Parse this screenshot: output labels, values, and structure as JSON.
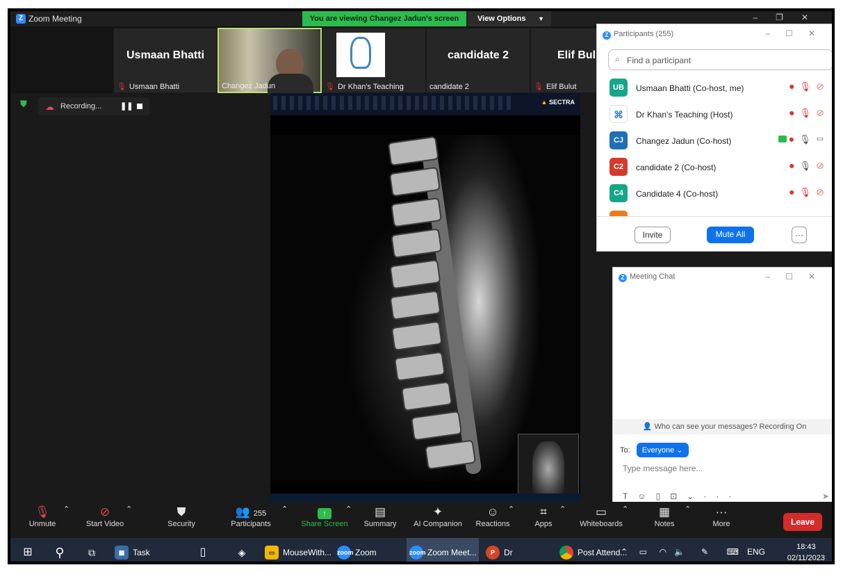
{
  "window": {
    "title": "Zoom Meeting",
    "viewing_banner": "You are viewing Changez Jadun's screen",
    "view_options": "View Options"
  },
  "thumbnails": [
    {
      "display": "Usmaan Bhatti",
      "name": "Usmaan Bhatti",
      "muted": true
    },
    {
      "display": "",
      "name": "Changez Jadun",
      "muted": false
    },
    {
      "display": "",
      "name": "Dr Khan's Teaching",
      "muted": true
    },
    {
      "display": "candidate 2",
      "name": "candidate 2",
      "muted": false
    },
    {
      "display": "Elif Bul",
      "name": "Elif Bulut",
      "muted": true
    }
  ],
  "recording": {
    "label": "Recording..."
  },
  "shared_screen": {
    "app_brand": "SECTRA"
  },
  "participants": {
    "title": "Participants (255)",
    "search_placeholder": "Find a participant",
    "list": [
      {
        "initials": "UB",
        "name": "Usmaan Bhatti (Co-host, me)",
        "color": "#17a589"
      },
      {
        "initials": "",
        "name": "Dr Khan's Teaching (Host)",
        "color": "#ffffff"
      },
      {
        "initials": "CJ",
        "name": "Changez Jadun (Co-host)",
        "color": "#1f6fb3"
      },
      {
        "initials": "C2",
        "name": "candidate 2 (Co-host)",
        "color": "#d33a2c"
      },
      {
        "initials": "C4",
        "name": "Candidate 4 (Co-host)",
        "color": "#17a589"
      }
    ],
    "invite": "Invite",
    "mute_all": "Mute All",
    "more": "···"
  },
  "chat": {
    "title": "Meeting Chat",
    "notice": "Who can see your messages? Recording On",
    "to_label": "To:",
    "to_value": "Everyone",
    "input_placeholder": "Type message here..."
  },
  "toolbar": {
    "unmute": "Unmute",
    "start_video": "Start Video",
    "security": "Security",
    "participants": "Participants",
    "participants_count": "255",
    "share_screen": "Share Screen",
    "summary": "Summary",
    "ai_companion": "AI Companion",
    "reactions": "Reactions",
    "apps": "Apps",
    "whiteboards": "Whiteboards",
    "notes": "Notes",
    "more": "More",
    "leave": "Leave"
  },
  "taskbar": {
    "items": [
      "Task Manager",
      "MouseWith...",
      "Zoom",
      "Zoom Meet...",
      "Dr Changez...",
      "Post Attend..."
    ],
    "lang": "ENG",
    "time": "18:43",
    "date": "02/11/2023"
  }
}
